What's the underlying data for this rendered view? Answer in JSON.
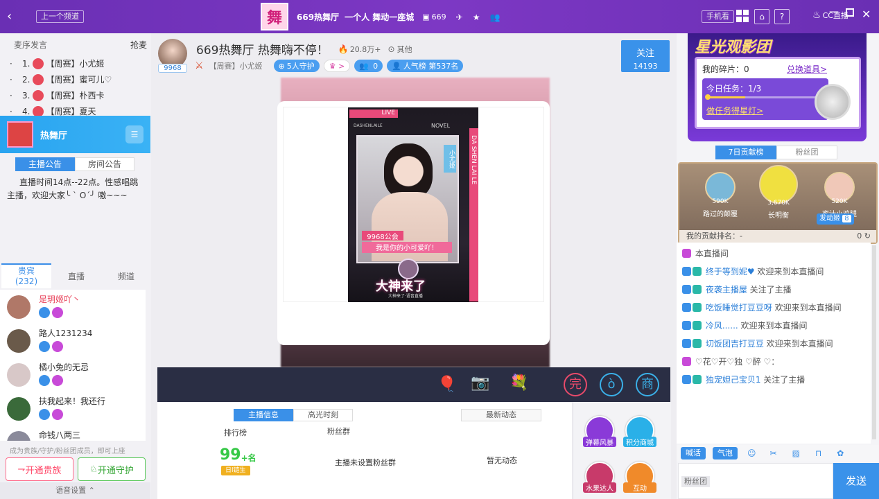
{
  "topbar": {
    "prev_channel": "上一个频道",
    "logo_char": "舞",
    "room_name": "669热舞厅",
    "slogan": "一个人 舞动一座城",
    "room_id": "669",
    "buttons": [
      "手机看"
    ],
    "brand": "CC直播"
  },
  "left": {
    "rank_header": "麦序发言",
    "rank_grab": "抢麦",
    "rank_list": [
      {
        "no": "1.",
        "tag": "【周赛】",
        "name": "小尤姬"
      },
      {
        "no": "2.",
        "tag": "【周赛】",
        "name": "蜜可儿♡"
      },
      {
        "no": "3.",
        "tag": "【周赛】",
        "name": "朴西卡"
      },
      {
        "no": "4.",
        "tag": "【周赛】",
        "name": "夏天"
      }
    ],
    "channel_name": "热舞厅",
    "notice_tabs": [
      "主播公告",
      "房间公告"
    ],
    "notice_text": "直播时间14点--22点。性感唱跳主播，欢迎大家╰ ` O´╯ 嗷~~~",
    "user_tabs": {
      "vip": "贵宾",
      "vip_count": "(232)",
      "live": "直播",
      "channel": "频道"
    },
    "users": [
      {
        "name": "是玥姬吖丶",
        "color": "#e8425a",
        "av": "#b07868"
      },
      {
        "name": "路人1231234",
        "color": "#333",
        "av": "#6a5a4a"
      },
      {
        "name": "橘小兔的无忌",
        "color": "#333",
        "av": "#d8c8c8"
      },
      {
        "name": "扶我起来！我还行",
        "color": "#333",
        "av": "#3a6a3a"
      },
      {
        "name": "命钱八两三",
        "color": "#333",
        "av": "#8a8a9a"
      }
    ],
    "promo": "成为贵族/守护/粉丝团成员，即可上座",
    "btn_noble": "开通贵族",
    "btn_guard": "开通守护",
    "voice_settings": "语音设置"
  },
  "header": {
    "anchor_id": "9968",
    "title": "669热舞厅 热舞嗨不停！",
    "heat": "20.8万+",
    "other": "其他",
    "tag": "【周赛】",
    "anchor_name": "小尤姬",
    "guard": "5人守护",
    "fans": "0",
    "popularity": "人气榜 第537名",
    "follow_label": "关注",
    "follow_count": "14193"
  },
  "poster": {
    "live": "LIVE",
    "novel": "NOVEL",
    "side_text": "DA SHEN LAI LE",
    "name_tag": "小尤姬",
    "guild": "9968公会",
    "slogan": "我是你的小可爱吖！",
    "title": "大神来了",
    "sub": "大神来了·语音直播",
    "top_left": "DASHENLAILE"
  },
  "info": {
    "tabs": [
      "主播信息",
      "高光时刻"
    ],
    "news_tab": "最新动态",
    "rank_label": "排行榜",
    "rank_value": "99",
    "rank_suffix": "+名",
    "rank_badge": "日l链生",
    "fans_label": "粉丝群",
    "fans_text": "主播未设置粉丝群",
    "news_text": "暂无动态"
  },
  "gifts": [
    {
      "label": "弹幕风暴",
      "color": "#8a3ad8"
    },
    {
      "label": "积分商城",
      "color": "#2ab0e8"
    },
    {
      "label": "水果达人",
      "color": "#c83a6a"
    },
    {
      "label": "互动",
      "color": "#f08a2a"
    }
  ],
  "right": {
    "banner_title": "星光观影团",
    "fragments": "我的碎片：0",
    "exchange": "兑换道具>",
    "task": "今日任务：1/3",
    "do_task": "做任务得星灯>",
    "tabs": [
      "7日贡献榜",
      "粉丝团"
    ],
    "top3": [
      {
        "score": "590K",
        "name": "路过的颠覆"
      },
      {
        "score": "3,670K",
        "name": "长明衡"
      },
      {
        "score": "520K",
        "name": "蜜汁小鸡腿"
      }
    ],
    "fan_tag": "发动姬",
    "fan_num": "8",
    "my_rank": "我的贡献排名：-",
    "chat": [
      {
        "name": "",
        "text": "本直播间"
      },
      {
        "name": "终于等到妮♥",
        "text": "欢迎来到本直播间"
      },
      {
        "name": "夜袭主播屋",
        "text": "关注了主播"
      },
      {
        "name": "吃饭睡觉打豆豆呀",
        "text": "欢迎来到本直播间"
      },
      {
        "name": "冷风......",
        "text": "欢迎来到本直播间"
      },
      {
        "name": "切饭团吉打豆豆",
        "text": "欢迎来到本直播间"
      },
      {
        "name": "",
        "text": "♡花♡开♡独 ♡醉 ♡："
      },
      {
        "name": "独宠妲己宝贝1",
        "text": "关注了主播"
      }
    ],
    "input_tabs": [
      "喊话",
      "气泡"
    ],
    "fan_group": "粉丝团",
    "send": "发送"
  }
}
